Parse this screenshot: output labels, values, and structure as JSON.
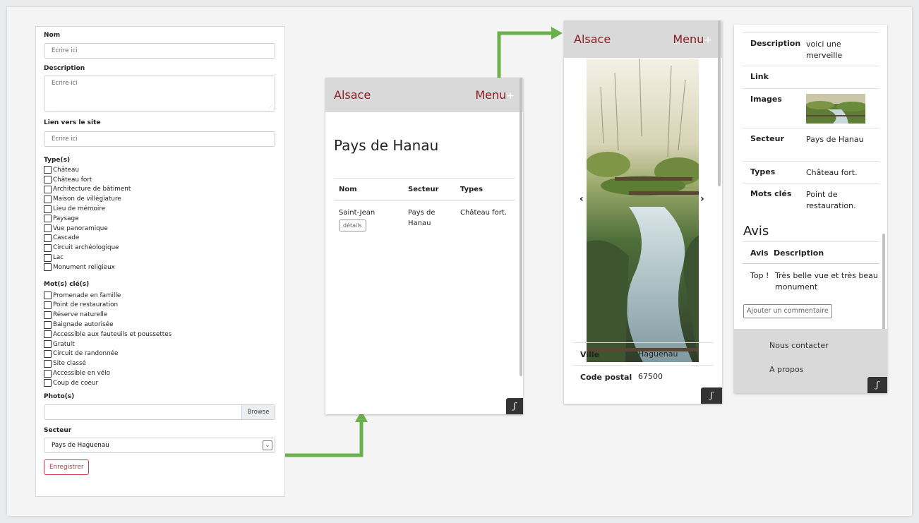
{
  "form": {
    "nom_label": "Nom",
    "nom_placeholder": "Ecrire ici",
    "description_label": "Description",
    "description_placeholder": "Ecrire ici",
    "lien_label": "Lien vers le site",
    "lien_placeholder": "Ecrire ici",
    "types_label": "Type(s)",
    "types": [
      "Château",
      "Château fort",
      "Architecture de bâtiment",
      "Maison de villégiature",
      "Lieu de mémoire",
      "Paysage",
      "Vue panoramique",
      "Cascade",
      "Circuit archéologique",
      "Lac",
      "Monument religieux"
    ],
    "mots_label": "Mot(s) clé(s)",
    "mots": [
      "Promenade en famille",
      "Point de restauration",
      "Réserve naturelle",
      "Baignade autorisée",
      "Accessible aux fauteuils et poussettes",
      "Gratuit",
      "Circuit de randonnée",
      "Site classé",
      "Accessible en vélo",
      "Coup de coeur"
    ],
    "photos_label": "Photo(s)",
    "browse_label": "Browse",
    "secteur_label": "Secteur",
    "secteur_value": "Pays de Haguenau",
    "save_label": "Enregistrer"
  },
  "list_view": {
    "brand": "Alsace",
    "menu": "Menu",
    "menu_plus": "+",
    "title": "Pays de Hanau",
    "headers": [
      "Nom",
      "Secteur",
      "Types"
    ],
    "row": {
      "nom": "Saint-Jean",
      "details_label": "détails",
      "secteur": "Pays de Hanau",
      "types": "Château fort."
    }
  },
  "detail_view": {
    "brand": "Alsace",
    "menu": "Menu",
    "menu_plus": "+",
    "prev": "‹",
    "next": "›",
    "ville_key": "Ville",
    "ville_val": "Haguenau",
    "code_key": "Code postal",
    "code_val": "67500"
  },
  "detail_view_bottom": {
    "description_key": "Description",
    "description_val": "voici une merveille",
    "link_key": "Link",
    "images_key": "Images",
    "secteur_key": "Secteur",
    "secteur_val": "Pays de Hanau",
    "types_key": "Types",
    "types_val": "Château fort.",
    "mots_key": "Mots clés",
    "mots_val": "Point de restauration.",
    "avis_title": "Avis",
    "avis_headers": [
      "Avis",
      "Description"
    ],
    "avis_row": {
      "avis": "Top !",
      "description": "Très belle vue et très beau monument"
    },
    "add_comment": "Ajouter un commentaire",
    "footer_contact": "Nous contacter",
    "footer_about": "A propos"
  },
  "badge_glyph": "ʃ",
  "colors": {
    "brand_red": "#8b1c24",
    "arrow_green": "#6ab04c",
    "header_gray": "#d9d9d9",
    "danger": "#dc3545"
  }
}
